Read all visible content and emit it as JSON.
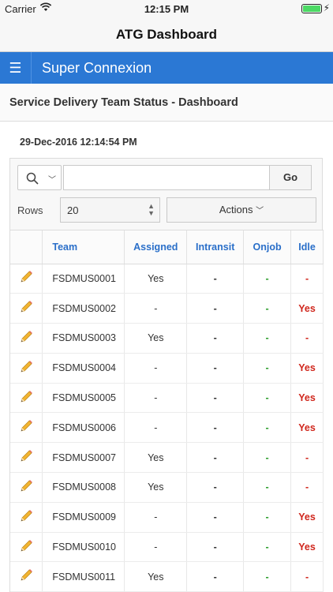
{
  "status_bar": {
    "carrier": "Carrier",
    "time": "12:15 PM"
  },
  "nav": {
    "title": "ATG Dashboard"
  },
  "app_header": {
    "menu_icon": "hamburger-icon",
    "title": "Super Connexion"
  },
  "page": {
    "region_title": "Service Delivery Team Status - Dashboard",
    "datetime": "29-Dec-2016 12:14:54 PM"
  },
  "toolbar": {
    "search_placeholder": "",
    "go_label": "Go",
    "rows_label": "Rows",
    "rows_value": "20",
    "actions_label": "Actions"
  },
  "table": {
    "columns": [
      "Team",
      "Assigned",
      "Intransit",
      "Onjob",
      "Idle"
    ],
    "rows": [
      {
        "team": "FSDMUS0001",
        "assigned": "Yes",
        "intransit": "-",
        "onjob": "-",
        "idle": "-"
      },
      {
        "team": "FSDMUS0002",
        "assigned": "-",
        "intransit": "-",
        "onjob": "-",
        "idle": "Yes"
      },
      {
        "team": "FSDMUS0003",
        "assigned": "Yes",
        "intransit": "-",
        "onjob": "-",
        "idle": "-"
      },
      {
        "team": "FSDMUS0004",
        "assigned": "-",
        "intransit": "-",
        "onjob": "-",
        "idle": "Yes"
      },
      {
        "team": "FSDMUS0005",
        "assigned": "-",
        "intransit": "-",
        "onjob": "-",
        "idle": "Yes"
      },
      {
        "team": "FSDMUS0006",
        "assigned": "-",
        "intransit": "-",
        "onjob": "-",
        "idle": "Yes"
      },
      {
        "team": "FSDMUS0007",
        "assigned": "Yes",
        "intransit": "-",
        "onjob": "-",
        "idle": "-"
      },
      {
        "team": "FSDMUS0008",
        "assigned": "Yes",
        "intransit": "-",
        "onjob": "-",
        "idle": "-"
      },
      {
        "team": "FSDMUS0009",
        "assigned": "-",
        "intransit": "-",
        "onjob": "-",
        "idle": "Yes"
      },
      {
        "team": "FSDMUS0010",
        "assigned": "-",
        "intransit": "-",
        "onjob": "-",
        "idle": "Yes"
      },
      {
        "team": "FSDMUS0011",
        "assigned": "Yes",
        "intransit": "-",
        "onjob": "-",
        "idle": "-"
      }
    ]
  },
  "colors": {
    "header_blue": "#2b78d4",
    "link_blue": "#2a6fc9",
    "onjob_green": "#2e9e2e",
    "idle_red": "#d0271d"
  }
}
